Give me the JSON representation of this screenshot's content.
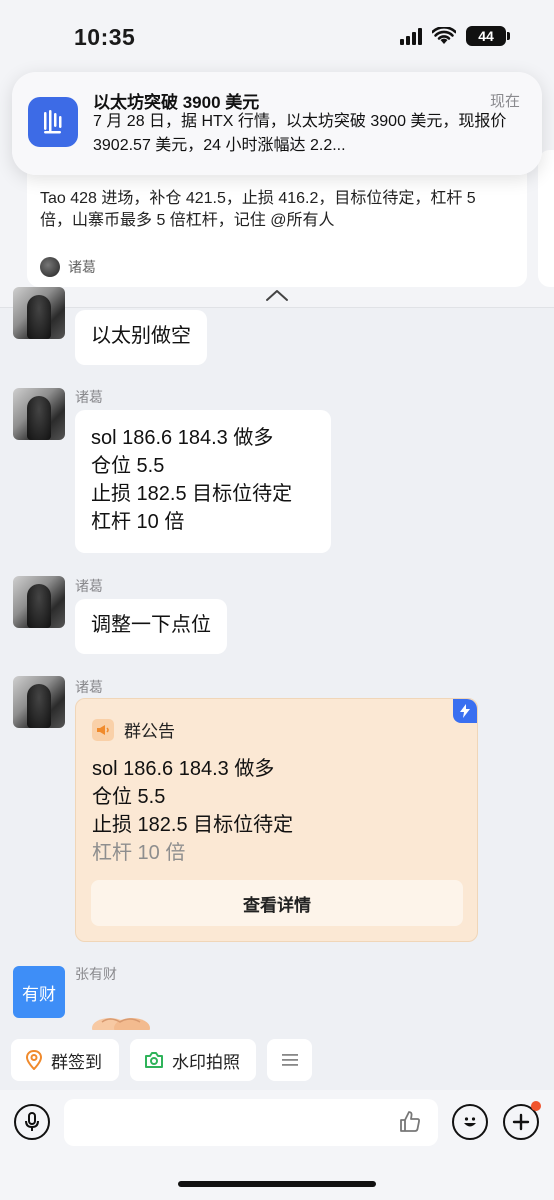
{
  "status_bar": {
    "time": "10:35",
    "battery": "44"
  },
  "notification": {
    "title": "以太坊突破 3900 美元",
    "time": "现在",
    "body": "7 月 28 日，据 HTX 行情，以太坊突破 3900 美元，现报价 3902.57 美元，24 小时涨幅达 2.2..."
  },
  "pinned_card": {
    "text": "Tao 428 进场，补仓 421.5，止损 416.2，目标位待定，杠杆 5 倍，山寨币最多 5 倍杠杆，记住 @所有人",
    "author": "诸葛"
  },
  "messages": [
    {
      "sender": "",
      "text": "以太别做空"
    },
    {
      "sender": "诸葛",
      "lines": [
        "sol  186.6  184.3 做多",
        "仓位 5.5",
        "止损 182.5  目标位待定",
        "杠杆 10 倍"
      ]
    },
    {
      "sender": "诸葛",
      "text": "调整一下点位"
    },
    {
      "sender": "诸葛",
      "announcement": {
        "header": "群公告",
        "lines": [
          "sol  186.6  184.3 做多",
          "仓位 5.5",
          "止损 182.5  目标位待定"
        ],
        "faded_line": "杠杆 10 倍",
        "button": "查看详情"
      }
    },
    {
      "sender": "张有财",
      "avatar_text": "有财"
    }
  ],
  "quick_actions": [
    "群签到",
    "水印拍照"
  ],
  "colors": {
    "accent": "#3d6be6",
    "announcement_bg": "#fbe8d4",
    "avatar_blue": "#3e8ef7",
    "badge_red": "#f0542d"
  }
}
